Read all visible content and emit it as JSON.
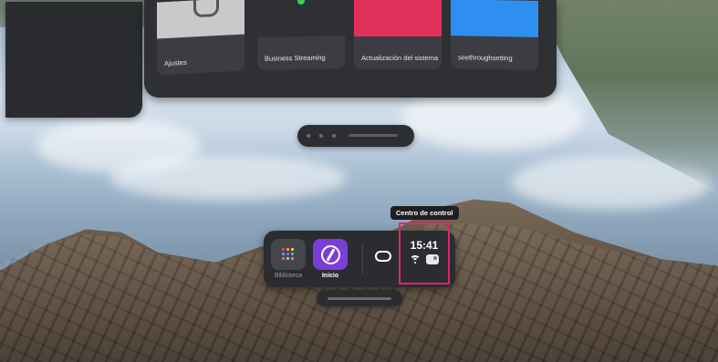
{
  "apps": [
    {
      "label": "Ajustes",
      "icon": "gear-icon"
    },
    {
      "label": "Business Streaming",
      "icon": "status-dot-icon"
    },
    {
      "label": "Actualización del sistema",
      "icon": "update-icon"
    },
    {
      "label": "seethroughsetting",
      "icon": "passthrough-icon"
    }
  ],
  "taskbar": {
    "library_label": "Biblioteca",
    "home_label": "Inicio",
    "clock": "15:41",
    "control_center_tooltip": "Centro de control"
  },
  "colors": {
    "accent_purple": "#7a3ed6",
    "highlight_pink": "#e0246c",
    "tile_red": "#e0315b",
    "tile_blue": "#2f8ff0",
    "status_green": "#37d35d"
  }
}
